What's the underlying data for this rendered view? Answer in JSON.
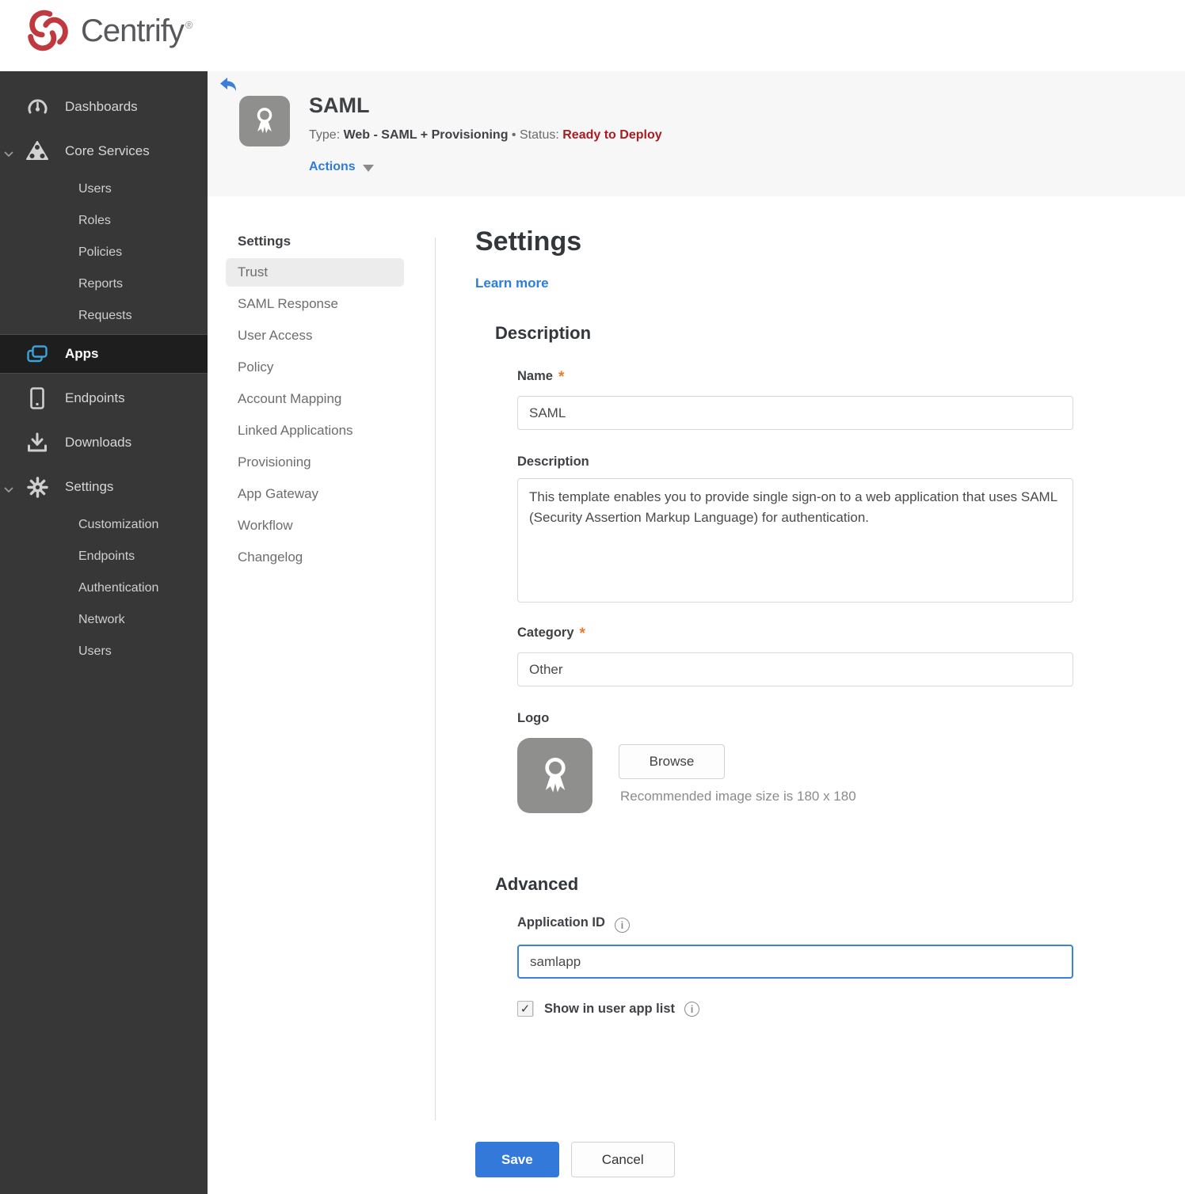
{
  "brand": {
    "name": "Centrify",
    "trademark": "®",
    "brand_red": "#c0393e"
  },
  "icons": {
    "info_glyph": "i",
    "check_glyph": "✓"
  },
  "sidebar": {
    "items": [
      {
        "label": "Dashboards"
      },
      {
        "label": "Core Services",
        "expanded": true,
        "children": [
          "Users",
          "Roles",
          "Policies",
          "Reports",
          "Requests"
        ]
      },
      {
        "label": "Apps",
        "active": true
      },
      {
        "label": "Endpoints"
      },
      {
        "label": "Downloads"
      },
      {
        "label": "Settings",
        "expanded": true,
        "children": [
          "Customization",
          "Endpoints",
          "Authentication",
          "Network",
          "Users"
        ]
      }
    ]
  },
  "header": {
    "title": "SAML",
    "type_label": "Type:",
    "type_value": "Web - SAML + Provisioning",
    "separator": "•",
    "status_label": "Status:",
    "status_value": "Ready to Deploy",
    "actions_label": "Actions"
  },
  "subnav": {
    "heading": "Settings",
    "items": [
      "Trust",
      "SAML Response",
      "User Access",
      "Policy",
      "Account Mapping",
      "Linked Applications",
      "Provisioning",
      "App Gateway",
      "Workflow",
      "Changelog"
    ],
    "active_item": "Trust"
  },
  "main": {
    "title": "Settings",
    "learn_more_label": "Learn more",
    "required_marker": "*",
    "description": {
      "heading": "Description",
      "name_label": "Name",
      "name_value": "SAML",
      "desc_label": "Description",
      "desc_value": "This template enables you to provide single sign-on to a web application that uses SAML (Security Assertion Markup Language) for authentication.",
      "category_label": "Category",
      "category_value": "Other",
      "logo_label": "Logo",
      "browse_label": "Browse",
      "recommended_text": "Recommended image size is 180 x 180"
    },
    "advanced": {
      "heading": "Advanced",
      "app_id_label": "Application ID",
      "app_id_value": "samlapp",
      "show_label": "Show in user app list",
      "show_checked": true
    },
    "footer": {
      "save_label": "Save",
      "cancel_label": "Cancel"
    }
  },
  "colors": {
    "accent_blue": "#3079d8",
    "status_red": "#a61d22",
    "asterisk_orange": "#e87a2e",
    "app_icon_blue": "#3aa3da",
    "sidebar_bg": "#373737",
    "header_band_bg": "#f7f7f8"
  }
}
